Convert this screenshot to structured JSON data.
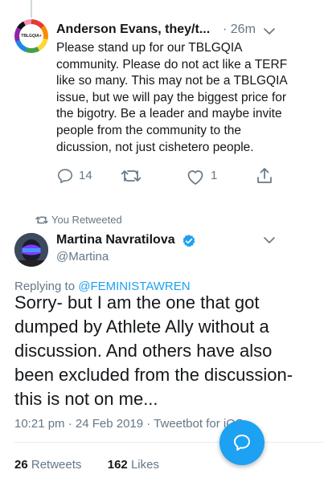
{
  "tweet1": {
    "avatar_text": "TBLGQIA+",
    "display_name": "Anderson Evans, they/t...",
    "time": "· 26m",
    "body": "Please stand up for our TBLGQIA community. Please do not act like a TERF like so many. This may not be a TBLGQIA issue, but we will pay the biggest price for the bigotry. Be a leader and maybe invite people from the community to the dicussion, not just cishetero people.",
    "reply_count": "14",
    "like_count": "1"
  },
  "retweet_label": "You Retweeted",
  "tweet2": {
    "display_name": "Martina Navratilova",
    "handle": "@Martina",
    "replying_prefix": "Replying to ",
    "replying_to": "@FEMINISTAWREN",
    "body": "Sorry- but I am the one that got dumped by Athlete Ally without a discussion. And others have also been excluded from the discussion- this is not on me...",
    "meta": "10:21 pm · 24 Feb 2019 · Tweetbot for iOS",
    "retweets_count": "26",
    "retweets_label": "Retweets",
    "likes_count": "162",
    "likes_label": "Likes"
  },
  "colors": {
    "accent": "#1da1f2",
    "muted": "#657786",
    "text": "#14171a"
  },
  "icons": [
    "reply-icon",
    "retweet-icon",
    "like-icon",
    "share-icon",
    "verified-badge-icon",
    "chevron-down-icon",
    "compose-icon"
  ]
}
